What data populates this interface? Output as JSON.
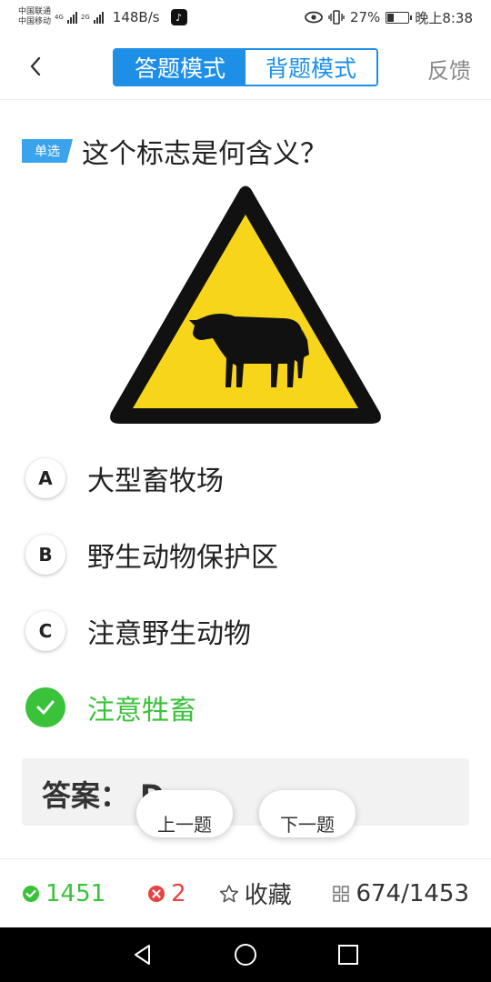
{
  "status": {
    "carrier1": "中国联通",
    "carrier2": "中国移动",
    "net1": "4G",
    "net2": "2G",
    "speed": "148B/s",
    "battery": "27%",
    "battery_level": 0.27,
    "time": "晚上8:38"
  },
  "header": {
    "mode_answer": "答题模式",
    "mode_memorize": "背题模式",
    "feedback": "反馈"
  },
  "question": {
    "type": "单选",
    "text": "这个标志是何含义？"
  },
  "options": [
    {
      "letter": "A",
      "text": "大型畜牧场"
    },
    {
      "letter": "B",
      "text": "野生动物保护区"
    },
    {
      "letter": "C",
      "text": "注意野生动物"
    },
    {
      "letter": "D",
      "text": "注意牲畜"
    }
  ],
  "answer": {
    "label": "答案：",
    "value": "D"
  },
  "nav": {
    "prev": "上一题",
    "next": "下一题"
  },
  "stats": {
    "correct": "1451",
    "wrong": "2",
    "favorite": "收藏",
    "progress": "674/1453"
  },
  "colors": {
    "accent": "#1e8fe6",
    "correct": "#3ac23a",
    "wrong": "#e64343",
    "sign_yellow": "#f7d51a"
  }
}
